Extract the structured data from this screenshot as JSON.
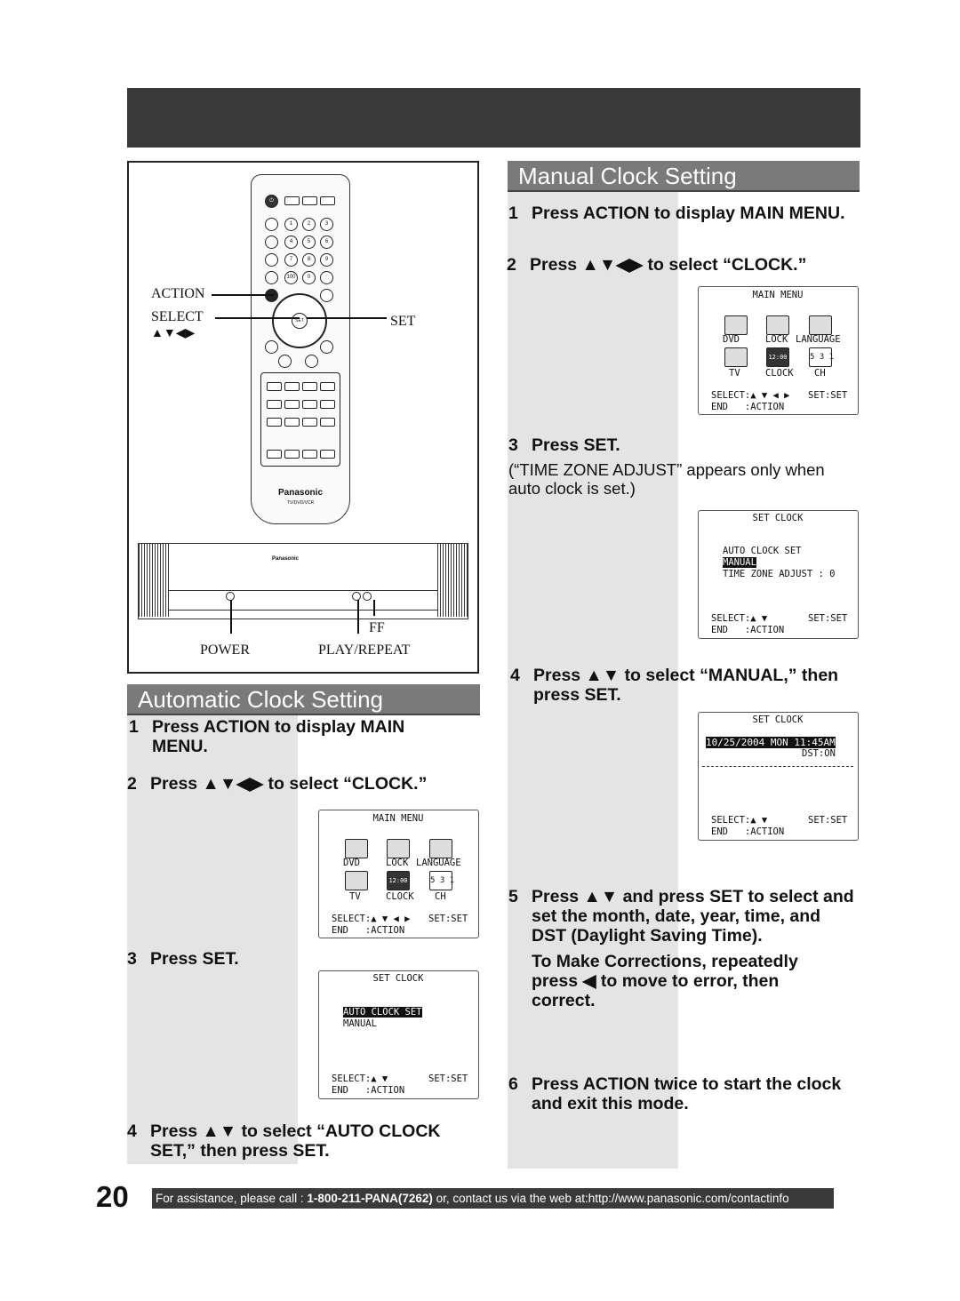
{
  "page_number": "20",
  "footer": {
    "text_before": "For assistance, please call : ",
    "phone": "1-800-211-PANA(7262)",
    "text_after": " or, contact us via the web at:http://www.panasonic.com/contactinfo"
  },
  "figure": {
    "labels": {
      "action": "ACTION",
      "select": "SELECT",
      "select_arrows": "▲▼◀▶",
      "set": "SET",
      "power": "POWER",
      "ff": "FF",
      "play_repeat": "PLAY/REPEAT"
    },
    "remote_brand": "Panasonic",
    "remote_model": "TV/DVD/VCR",
    "tv_brand": "Panasonic"
  },
  "auto": {
    "title": "Automatic Clock Setting",
    "steps": [
      {
        "n": "1",
        "text": "Press ACTION to display MAIN MENU."
      },
      {
        "n": "2",
        "text": "Press ▲▼◀▶ to select “CLOCK.”"
      },
      {
        "n": "3",
        "text": "Press SET."
      },
      {
        "n": "4",
        "text": "Press ▲▼ to select “AUTO CLOCK SET,” then press SET."
      }
    ]
  },
  "manual": {
    "title": "Manual Clock Setting",
    "steps": [
      {
        "n": "1",
        "text": "Press ACTION to display MAIN MENU."
      },
      {
        "n": "2",
        "text": "Press ▲▼◀▶ to select “CLOCK.”"
      },
      {
        "n": "3",
        "text": "Press SET."
      },
      {
        "n": "4",
        "text": "Press ▲▼ to select “MANUAL,” then press SET."
      },
      {
        "n": "5",
        "text": "Press ▲▼ and press SET to select and set the month, date, year, time, and DST (Daylight Saving Time)."
      },
      {
        "n": "6",
        "text": "Press ACTION twice to start the clock and exit this mode."
      }
    ],
    "note3": "(“TIME ZONE ADJUST” appears only when auto clock is set.)",
    "note5": "To Make Corrections, repeatedly press ◀ to move to error, then correct."
  },
  "osd": {
    "main_menu": {
      "title": "MAIN MENU",
      "items": [
        "DVD",
        "LOCK",
        "LANGUAGE",
        "TV",
        "CLOCK",
        "CH"
      ],
      "clock_icon_text": "12:00",
      "ch_icon_text": "5 3 1",
      "select": "SELECT:▲ ▼ ◀ ▶",
      "set": "SET:SET",
      "end": "END   :ACTION"
    },
    "set_clock_auto": {
      "title": "SET CLOCK",
      "opt1": "AUTO CLOCK SET",
      "opt2": "MANUAL",
      "select": "SELECT:▲ ▼",
      "set": "SET:SET",
      "end": "END   :ACTION"
    },
    "set_clock_manual": {
      "title": "SET CLOCK",
      "opt1": "AUTO CLOCK SET",
      "opt2": "MANUAL",
      "tz": "TIME ZONE ADJUST : 0",
      "select": "SELECT:▲ ▼",
      "set": "SET:SET",
      "end": "END   :ACTION"
    },
    "set_clock_time": {
      "title": "SET CLOCK",
      "datetime": "10/25/2004 MON 11:45AM",
      "dst": "DST:ON",
      "select": "SELECT:▲ ▼",
      "set": "SET:SET",
      "end": "END   :ACTION"
    }
  }
}
